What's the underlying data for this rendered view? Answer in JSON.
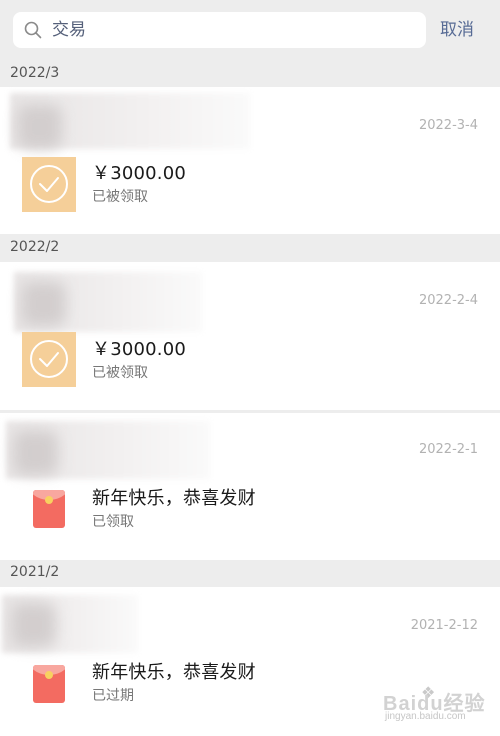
{
  "search": {
    "query": "交易",
    "cancel_label": "取消"
  },
  "sections": [
    {
      "label": "2022/3"
    },
    {
      "label": "2022/2"
    },
    {
      "label": "2021/2"
    }
  ],
  "items": [
    {
      "date": "2022-3-4",
      "title": "￥3000.00",
      "status": "已被领取",
      "icon": "check-circle-icon"
    },
    {
      "date": "2022-2-4",
      "title": "￥3000.00",
      "status": "已被领取",
      "icon": "check-circle-icon"
    },
    {
      "date": "2022-2-1",
      "title": "新年快乐，恭喜发财",
      "status": "已领取",
      "icon": "red-envelope-icon"
    },
    {
      "date": "2021-2-12",
      "title": "新年快乐，恭喜发财",
      "status": "已过期",
      "icon": "red-envelope-icon"
    }
  ],
  "watermark": {
    "brand": "Baidu经验",
    "url": "jingyan.baidu.com"
  },
  "colors": {
    "accent": "#576b95",
    "check_tile": "#f5cf99",
    "envelope": "#f36b61"
  }
}
